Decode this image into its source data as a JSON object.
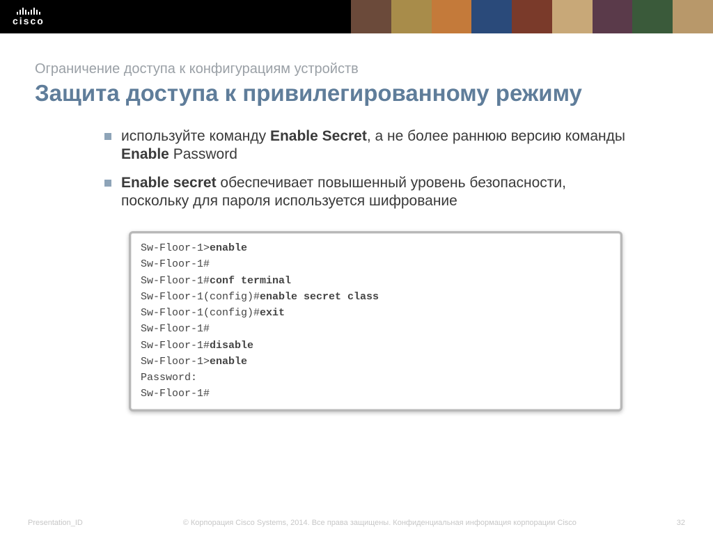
{
  "header": {
    "logo_text": "cisco"
  },
  "slide": {
    "subtitle": "Ограничение доступа к конфигурациям устройств",
    "title": "Защита доступа к привилегированному режиму",
    "bullets": [
      {
        "pre": "используйте команду ",
        "strong1": "Enable Secret",
        "mid": ", а не более раннюю версию команды ",
        "strong2": "Enable",
        "post": " Password"
      },
      {
        "pre": "",
        "strong1": "Enable secret",
        "mid": "  обеспечивает повышенный уровень безопасности, поскольку для пароля используется шифрование",
        "strong2": "",
        "post": ""
      }
    ],
    "terminal": [
      {
        "prompt": "Sw-Floor-1>",
        "cmd": "enable"
      },
      {
        "prompt": "Sw-Floor-1#",
        "cmd": ""
      },
      {
        "prompt": "Sw-Floor-1#",
        "cmd": "conf terminal"
      },
      {
        "prompt": "Sw-Floor-1(config)#",
        "cmd": "enable secret class"
      },
      {
        "prompt": "Sw-Floor-1(config)#",
        "cmd": "exit"
      },
      {
        "prompt": "Sw-Floor-1#",
        "cmd": ""
      },
      {
        "prompt": "Sw-Floor-1#",
        "cmd": "disable"
      },
      {
        "prompt": "Sw-Floor-1>",
        "cmd": "enable"
      },
      {
        "prompt": "Password:",
        "cmd": ""
      },
      {
        "prompt": "Sw-Floor-1#",
        "cmd": ""
      }
    ]
  },
  "footer": {
    "left": "Presentation_ID",
    "center": "© Корпорация Cisco Systems, 2014. Все права защищены.     Конфиденциальная информация корпорации Cisco",
    "right": "32"
  }
}
